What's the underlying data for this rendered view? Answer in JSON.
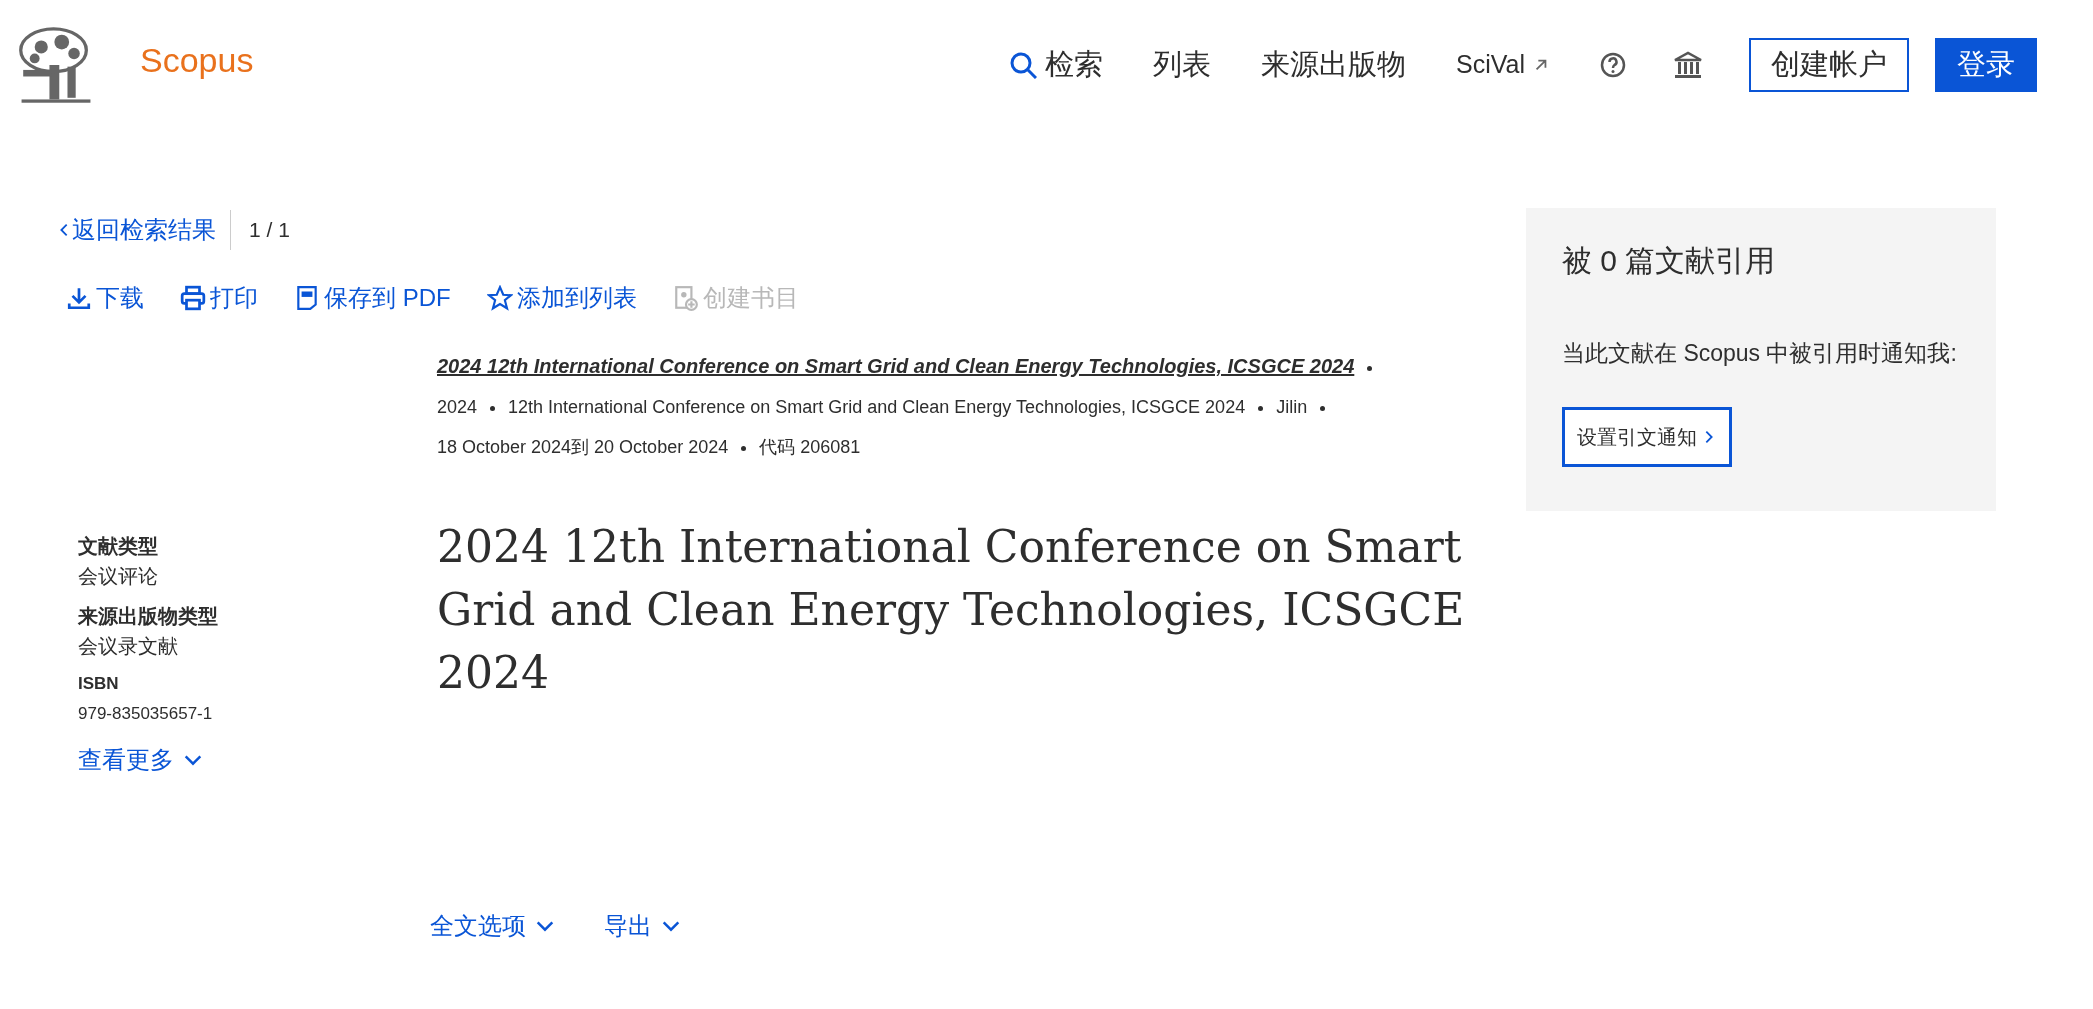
{
  "header": {
    "brand": "Scopus",
    "nav": [
      {
        "kind": "search",
        "label": "检索"
      },
      {
        "kind": "plain",
        "label": "列表"
      },
      {
        "kind": "plain",
        "label": "来源出版物"
      },
      {
        "kind": "external",
        "label": "SciVal"
      }
    ],
    "buttons": [
      {
        "kind": "outline",
        "label": "创建帐户"
      },
      {
        "kind": "solid",
        "label": "登录"
      }
    ]
  },
  "back": {
    "label": "返回检索结果",
    "position": "1 / 1"
  },
  "toolbar": [
    {
      "label": "下载",
      "disabled": false
    },
    {
      "label": "打印",
      "disabled": false
    },
    {
      "label": "保存到 PDF",
      "disabled": false
    },
    {
      "label": "添加到列表",
      "disabled": false
    },
    {
      "label": "创建书目",
      "disabled": true
    }
  ],
  "source": {
    "title": "2024 12th International Conference on Smart Grid and Clean Energy Technologies, ICSGCE 2024",
    "details": [
      "2024",
      "12th International Conference on Smart Grid and Clean Energy Technologies, ICSGCE 2024",
      "Jilin",
      "18 October 2024到 20 October 2024",
      "代码 206081"
    ]
  },
  "meta": [
    {
      "label": "文献类型",
      "value": "会议评论"
    },
    {
      "label": "来源出版物类型",
      "value": "会议录文献"
    },
    {
      "label": "ISBN",
      "value": "979-835035657-1"
    }
  ],
  "show_more": "查看更多",
  "title": "2024 12th International Conference on Smart Grid and Clean Energy Technologies, ICSGCE 2024",
  "bottom_links": [
    "全文选项",
    "导出"
  ],
  "cited_panel": {
    "heading": "被 0 篇文献引用",
    "text": "当此文献在 Scopus 中被引用时通知我:",
    "button": "设置引文通知"
  }
}
